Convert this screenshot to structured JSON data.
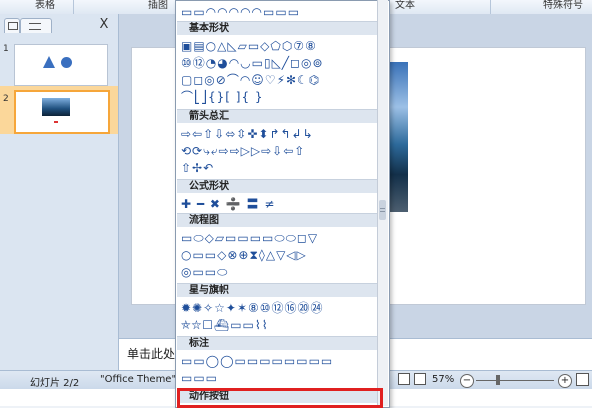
{
  "ribbon": {
    "groups": [
      "表格",
      "插图",
      "文本",
      "特殊符号"
    ]
  },
  "left_panel": {
    "tabs": [
      "",
      "",
      "X"
    ],
    "slides": [
      {
        "number": "1"
      },
      {
        "number": "2"
      }
    ]
  },
  "notes": {
    "placeholder": "单击此处"
  },
  "status": {
    "slide_info": "幻灯片 2/2",
    "theme": "\"Office Theme\"",
    "zoom": "57%"
  },
  "dropdown": {
    "sections": [
      {
        "title": "基本形状",
        "rows": [
          "▣▤○△◺▱▭◇⬠⬡⑦⑧",
          "⑩⑫◔◕◠◡▭▯◺╱◻◎⊚",
          "▢◻◎⊘⌒◠☺♡⚡✻☾⌬",
          "⌒⎣⎦{}[ ]{ }"
        ]
      },
      {
        "title": "箭头总汇",
        "rows": [
          "⇨⇦⇧⇩⬄⇳✜⬍↱↰↲↳",
          "⟲⟳⤷⤶⇨⇨▷▷⇨⇩⇦⇧",
          "⇧✢↶"
        ]
      },
      {
        "title": "公式形状",
        "rows": [
          "✚ ━ ✖ ➗ 〓 ≠"
        ]
      },
      {
        "title": "流程图",
        "rows": [
          "▭⬭◇▱▭▭▭▭⬭⬭◻▽",
          "○▭▭◇⊗⊕⧗◊△▽◁▷",
          "◎▭▭⬭"
        ]
      },
      {
        "title": "星与旗帜",
        "rows": [
          "✹✺✧☆✦✶⑧⑩⑫⑯⑳㉔",
          "⛤⛥☐⛴▭▭⌇⌇"
        ]
      },
      {
        "title": "标注",
        "rows": [
          "▭▭◯◯▭▭▭▭▭▭▭▭",
          "▭▭▭"
        ]
      },
      {
        "title": "动作按钮",
        "rows": []
      }
    ]
  },
  "colors": {
    "accent_orange": "#f6a63a",
    "highlight_red": "#e02020",
    "ribbon_blue": "#dbe5f1"
  }
}
